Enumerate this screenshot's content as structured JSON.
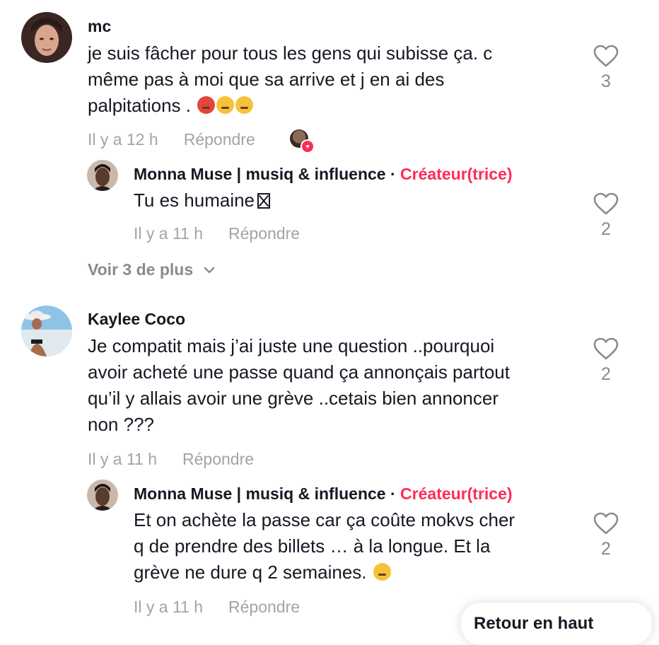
{
  "comments": [
    {
      "author": "mc",
      "lines": [
        "je suis fâcher pour tous les gens qui subisse ça. c",
        "même pas à moi que sa arrive et j en ai des",
        "palpitations ."
      ],
      "time": "Il y a 12 h",
      "reply_label": "Répondre",
      "likes": "3",
      "creator_liked": true,
      "replies": [
        {
          "author": "Monna Muse | musiq & influence",
          "separator": "·",
          "badge": "Créateur(trice)",
          "lines": [
            "Tu es humaine"
          ],
          "time": "Il y a 11 h",
          "reply_label": "Répondre",
          "likes": "2"
        }
      ],
      "more_replies": "Voir 3 de plus"
    },
    {
      "author": "Kaylee Coco",
      "lines": [
        "Je compatit mais j’ai juste une question ..pourquoi",
        "avoir acheté une passe quand ça annonçais partout",
        "qu’il y allais avoir une grève ..cetais bien annoncer",
        "non ???"
      ],
      "time": "Il y a 11 h",
      "reply_label": "Répondre",
      "likes": "2",
      "replies": [
        {
          "author": "Monna Muse | musiq & influence",
          "separator": "·",
          "badge": "Créateur(trice)",
          "lines": [
            "Et on achète la passe car ça coûte mokvs cher",
            "q de prendre des billets … à la longue. Et la",
            "grève ne dure q 2 semaines."
          ],
          "time": "Il y a 11 h",
          "reply_label": "Répondre",
          "likes": "2"
        }
      ]
    }
  ],
  "popup": {
    "label": "Retour en haut"
  },
  "icons": {
    "like": "heart-outline-icon",
    "expand": "chevron-down-icon"
  },
  "colors": {
    "text": "#161823",
    "muted": "#a2a3a8",
    "creator_badge": "#fe2c55"
  }
}
